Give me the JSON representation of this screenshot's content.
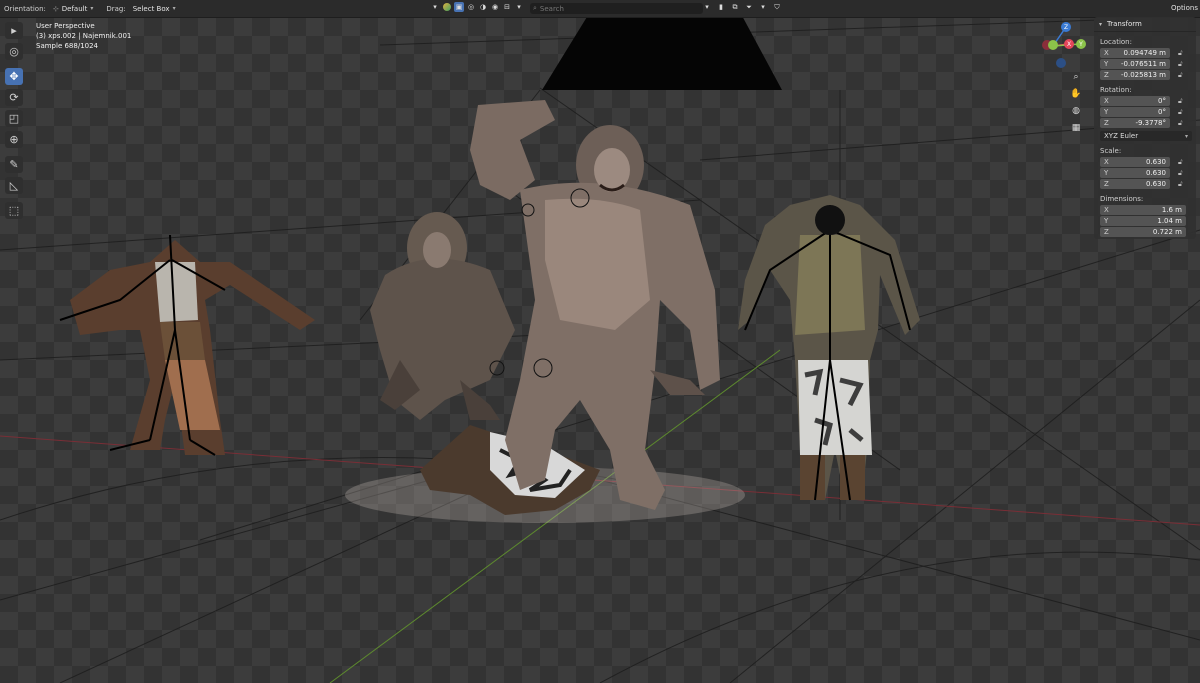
{
  "header": {
    "orientation_label": "Orientation:",
    "orientation_value": "Default",
    "drag_label": "Drag:",
    "drag_value": "Select Box",
    "search_placeholder": "Search",
    "options_label": "Options"
  },
  "view_info": {
    "line1": "User Perspective",
    "line2": "(3) xps.002 | Najemnik.001",
    "line3": "Sample 688/1024"
  },
  "toolbar": {
    "tools": [
      {
        "name": "select-box-tool",
        "icon": "cursor-arrow-icon",
        "active": false
      },
      {
        "name": "cursor-tool",
        "icon": "crosshair-icon",
        "active": false
      },
      {
        "name": "move-tool",
        "icon": "move-arrows-icon",
        "active": true
      },
      {
        "name": "rotate-tool",
        "icon": "rotate-icon",
        "active": false
      },
      {
        "name": "scale-tool",
        "icon": "scale-icon",
        "active": false
      },
      {
        "name": "transform-tool",
        "icon": "transform-icon",
        "active": false
      },
      {
        "name": "annotate-tool",
        "icon": "pencil-icon",
        "active": false
      },
      {
        "name": "measure-tool",
        "icon": "ruler-icon",
        "active": false
      },
      {
        "name": "add-cube-tool",
        "icon": "cube-icon",
        "active": false
      }
    ]
  },
  "gizmo": {
    "x": "X",
    "y": "Y",
    "z": "Z"
  },
  "panel": {
    "title": "Transform",
    "location_label": "Location:",
    "location": [
      {
        "axis": "X",
        "value": "0.094749 m"
      },
      {
        "axis": "Y",
        "value": "-0.076511 m"
      },
      {
        "axis": "Z",
        "value": "-0.025813 m"
      }
    ],
    "rotation_label": "Rotation:",
    "rotation": [
      {
        "axis": "X",
        "value": "0°"
      },
      {
        "axis": "Y",
        "value": "0°"
      },
      {
        "axis": "Z",
        "value": "-9.3778°"
      }
    ],
    "rotation_mode": "XYZ Euler",
    "scale_label": "Scale:",
    "scale": [
      {
        "axis": "X",
        "value": "0.630"
      },
      {
        "axis": "Y",
        "value": "0.630"
      },
      {
        "axis": "Z",
        "value": "0.630"
      }
    ],
    "dimensions_label": "Dimensions:",
    "dimensions": [
      {
        "axis": "X",
        "value": "1.6 m"
      },
      {
        "axis": "Y",
        "value": "1.04 m"
      },
      {
        "axis": "Z",
        "value": "0.722 m"
      }
    ]
  },
  "colors": {
    "accent": "#4772b3",
    "axis_x": "#e4465a",
    "axis_y": "#8bc34a",
    "axis_z": "#3a7bd5"
  }
}
